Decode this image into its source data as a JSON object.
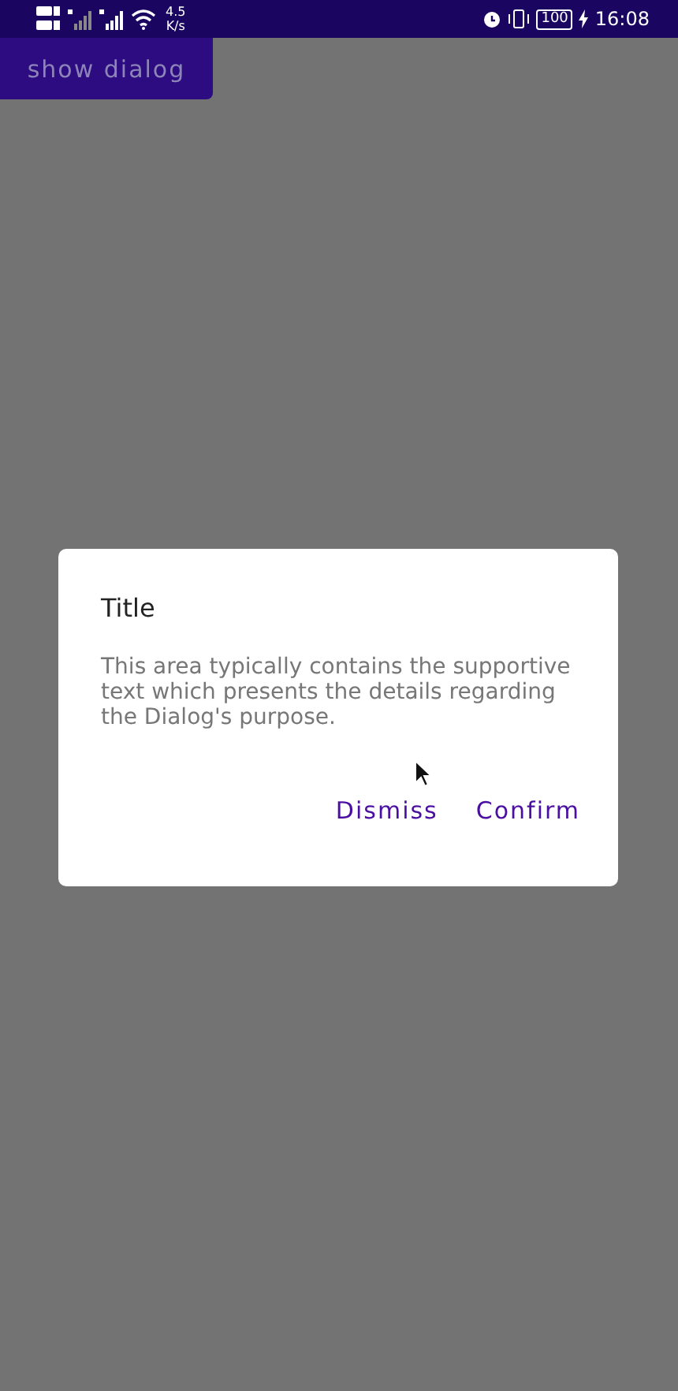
{
  "status_bar": {
    "speed_value": "4.5",
    "speed_unit": "K/s",
    "battery": "100",
    "time": "16:08"
  },
  "button": {
    "label": "show dialog"
  },
  "dialog": {
    "title": "Title",
    "text": "This area typically contains the supportive text which presents the details regarding the Dialog's purpose.",
    "actions": [
      {
        "label": "Dismiss"
      },
      {
        "label": "Confirm"
      }
    ]
  }
}
